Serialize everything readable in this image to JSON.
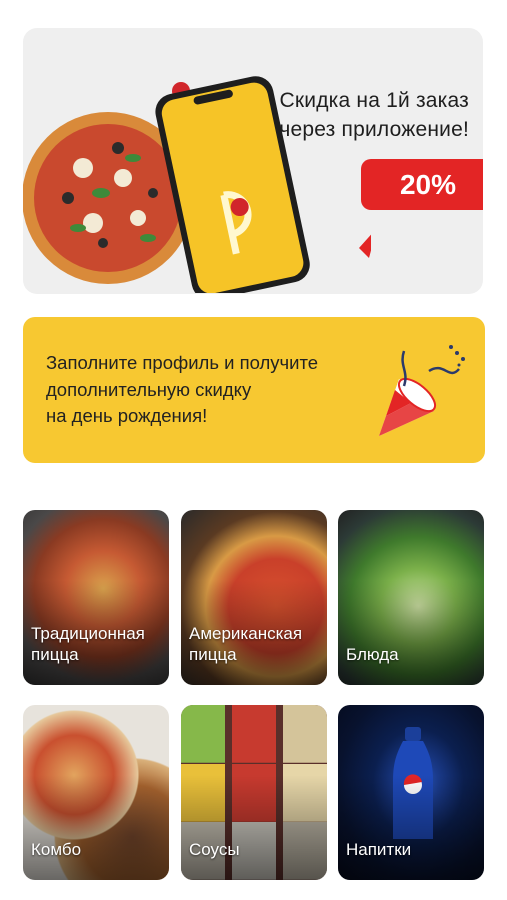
{
  "promo": {
    "line1": "Скидка на 1й заказ",
    "line2": "через приложение!",
    "discount": "20%",
    "carousel": {
      "count": 3,
      "active_index": 2
    }
  },
  "info_card": {
    "line1": "Заполните профиль и получите",
    "line2": "дополнительную скидку",
    "line3": "на день рождения!"
  },
  "categories": [
    {
      "label": "Традиционная пицца",
      "icon": "pizza-photo"
    },
    {
      "label": "Американская пицца",
      "icon": "pepperoni-photo"
    },
    {
      "label": "Блюда",
      "icon": "salad-photo"
    },
    {
      "label": "Комбо",
      "icon": "combo-photo"
    },
    {
      "label": "Соусы",
      "icon": "sauces-photo"
    },
    {
      "label": "Напитки",
      "icon": "pepsi-photo"
    }
  ],
  "colors": {
    "accent_yellow": "#f7c831",
    "badge_red": "#e32525"
  }
}
